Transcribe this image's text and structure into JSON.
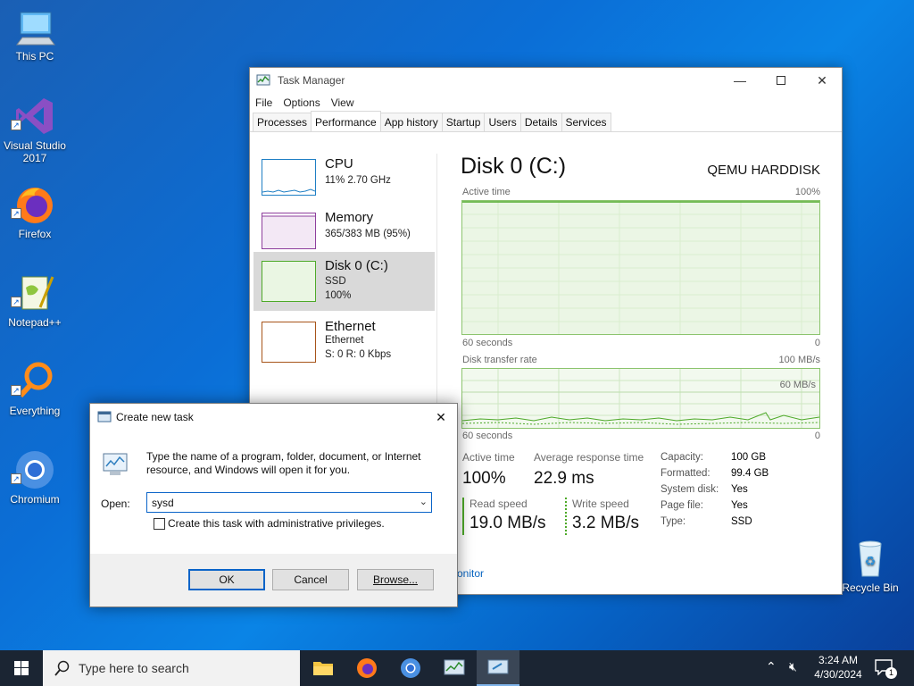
{
  "desktop": {
    "icons": [
      {
        "label": "This PC",
        "icon": "computer-icon"
      },
      {
        "label": "Visual Studio 2017",
        "icon": "visual-studio-icon"
      },
      {
        "label": "Firefox",
        "icon": "firefox-icon"
      },
      {
        "label": "Notepad++",
        "icon": "notepadpp-icon"
      },
      {
        "label": "Everything",
        "icon": "everything-icon"
      },
      {
        "label": "Chromium",
        "icon": "chromium-icon"
      },
      {
        "label": "Recycle Bin",
        "icon": "recycle-bin-icon"
      }
    ]
  },
  "taskmgr": {
    "title": "Task Manager",
    "menu": [
      "File",
      "Options",
      "View"
    ],
    "tabs": [
      "Processes",
      "Performance",
      "App history",
      "Startup",
      "Users",
      "Details",
      "Services"
    ],
    "active_tab": "Performance",
    "resources": [
      {
        "name": "CPU",
        "line1": "11% 2.70 GHz",
        "line2": "",
        "color": "#1f7fc4"
      },
      {
        "name": "Memory",
        "line1": "365/383 MB (95%)",
        "line2": "",
        "color": "#8e3f9d"
      },
      {
        "name": "Disk 0 (C:)",
        "line1": "SSD",
        "line2": "100%",
        "color": "#4da928"
      },
      {
        "name": "Ethernet",
        "line1": "Ethernet",
        "line2_prefix": "S: 0 R: 0 Kbps",
        "color": "#a7541a"
      }
    ],
    "detail": {
      "title": "Disk 0 (C:)",
      "device": "QEMU HARDDISK",
      "active_time_label": "Active time",
      "active_time_max": "100%",
      "axis_60": "60 seconds",
      "axis_zero": "0",
      "transfer_label": "Disk transfer rate",
      "transfer_max": "100 MB/s",
      "transfer_line": "60 MB/s",
      "stats": {
        "active_time_label": "Active time",
        "active_time_value": "100%",
        "avg_resp_label": "Average response time",
        "avg_resp_value": "22.9 ms",
        "read_label": "Read speed",
        "read_value": "19.0 MB/s",
        "write_label": "Write speed",
        "write_value": "3.2 MB/s"
      },
      "props": [
        {
          "k": "Capacity:",
          "v": "100 GB"
        },
        {
          "k": "Formatted:",
          "v": "99.4 GB"
        },
        {
          "k": "System disk:",
          "v": "Yes"
        },
        {
          "k": "Page file:",
          "v": "Yes"
        },
        {
          "k": "Type:",
          "v": "SSD"
        }
      ]
    },
    "footer_link": "onitor"
  },
  "run": {
    "title": "Create new task",
    "message": "Type the name of a program, folder, document, or Internet resource, and Windows will open it for you.",
    "open_label": "Open:",
    "open_value": "sysd",
    "admin_label": "Create this task with administrative privileges.",
    "ok": "OK",
    "cancel": "Cancel",
    "browse": "Browse..."
  },
  "taskbar": {
    "search_placeholder": "Type here to search",
    "time": "3:24 AM",
    "date": "4/30/2024",
    "notification_count": "1"
  }
}
